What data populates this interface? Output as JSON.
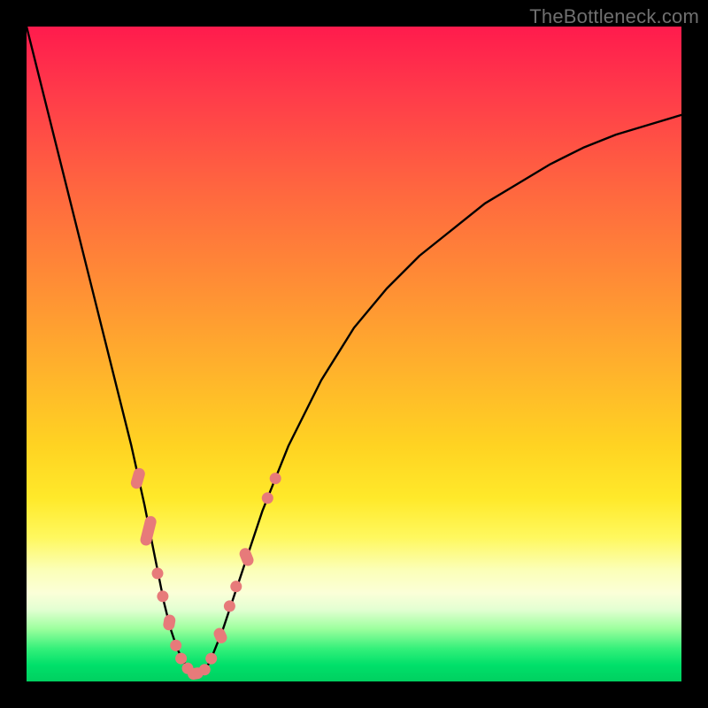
{
  "watermark": {
    "text": "TheBottleneck.com"
  },
  "colors": {
    "curve": "#000000",
    "marker_fill": "#e77a7a",
    "marker_stroke": "#d55f5f"
  },
  "chart_data": {
    "type": "line",
    "title": "",
    "xlabel": "",
    "ylabel": "",
    "xlim": [
      0,
      100
    ],
    "ylim": [
      0,
      100
    ],
    "grid": false,
    "series": [
      {
        "name": "bottleneck-curve",
        "x": [
          0,
          2,
          4,
          6,
          8,
          10,
          12,
          14,
          16,
          18,
          20,
          21,
          22,
          23,
          24,
          25,
          26,
          27,
          28,
          30,
          33,
          36,
          40,
          45,
          50,
          55,
          60,
          65,
          70,
          75,
          80,
          85,
          90,
          95,
          100
        ],
        "y": [
          100,
          92,
          84,
          76,
          68,
          60,
          52,
          44,
          36,
          27,
          17,
          12,
          8,
          5,
          3,
          1.5,
          1,
          1.5,
          3,
          8,
          17,
          26,
          36,
          46,
          54,
          60,
          65,
          69,
          73,
          76,
          79,
          81.5,
          83.5,
          85,
          86.5
        ]
      }
    ],
    "markers": {
      "name": "highlighted-points",
      "shape": "capsule",
      "points": [
        {
          "x": 17.0,
          "y": 31.0,
          "len": 3.2,
          "angle": -74
        },
        {
          "x": 18.6,
          "y": 23.0,
          "len": 4.6,
          "angle": -76
        },
        {
          "x": 20.0,
          "y": 16.5,
          "len": 1.6,
          "angle": -78
        },
        {
          "x": 20.8,
          "y": 13.0,
          "len": 1.6,
          "angle": -78
        },
        {
          "x": 21.8,
          "y": 9.0,
          "len": 2.4,
          "angle": -80
        },
        {
          "x": 22.8,
          "y": 5.5,
          "len": 1.6,
          "angle": -80
        },
        {
          "x": 23.6,
          "y": 3.5,
          "len": 1.4,
          "angle": -78
        },
        {
          "x": 24.6,
          "y": 2.0,
          "len": 1.4,
          "angle": -65
        },
        {
          "x": 25.8,
          "y": 1.2,
          "len": 2.4,
          "angle": -10
        },
        {
          "x": 27.2,
          "y": 1.8,
          "len": 1.4,
          "angle": 40
        },
        {
          "x": 28.2,
          "y": 3.5,
          "len": 1.6,
          "angle": 62
        },
        {
          "x": 29.6,
          "y": 7.0,
          "len": 2.4,
          "angle": 66
        },
        {
          "x": 31.0,
          "y": 11.5,
          "len": 1.6,
          "angle": 68
        },
        {
          "x": 32.0,
          "y": 14.5,
          "len": 1.6,
          "angle": 68
        },
        {
          "x": 33.6,
          "y": 19.0,
          "len": 2.8,
          "angle": 68
        },
        {
          "x": 36.8,
          "y": 28.0,
          "len": 1.6,
          "angle": 66
        },
        {
          "x": 38.0,
          "y": 31.0,
          "len": 1.6,
          "angle": 64
        }
      ]
    }
  }
}
